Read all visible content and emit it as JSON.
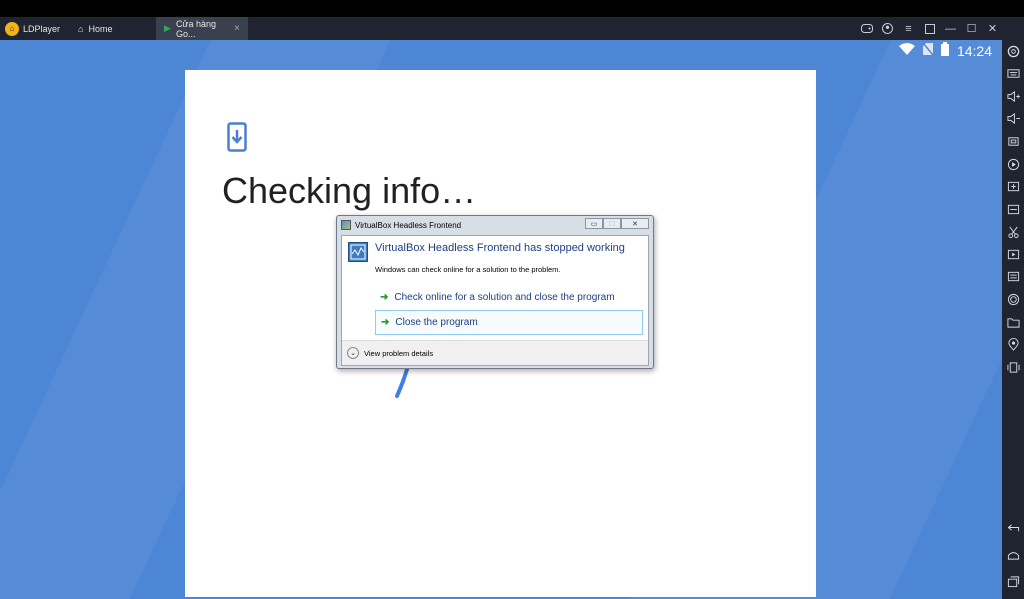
{
  "window": {
    "app_name": "LDPlayer",
    "tabs": [
      {
        "label": "Home",
        "icon": "home-icon"
      },
      {
        "label": "Cửa hàng Go...",
        "icon": "play-store-icon"
      }
    ],
    "controls": [
      "gamepad-icon",
      "account-icon",
      "menu-icon",
      "fullscreen-icon",
      "minimize-icon",
      "maximize-icon",
      "close-icon",
      "collapse-sidebar-icon"
    ]
  },
  "statusbar": {
    "time": "14:24",
    "icons": [
      "wifi-icon",
      "no-sim-icon",
      "battery-icon"
    ]
  },
  "screen": {
    "title": "Checking info…",
    "icon": "phone-download-icon"
  },
  "dialog": {
    "title": "VirtualBox Headless Frontend",
    "heading": "VirtualBox Headless Frontend has stopped working",
    "message": "Windows can check online for a solution to the problem.",
    "options": [
      "Check online for a solution and close the program",
      "Close the program"
    ],
    "details_label": "View problem details"
  },
  "sidebar": {
    "items": [
      "settings-icon",
      "keyboard-icon",
      "volume-up-icon",
      "volume-down-icon",
      "screenshot-icon",
      "record-icon",
      "add-apk-icon",
      "resolution-icon",
      "scissors-icon",
      "video-icon",
      "sync-icon",
      "rotate-icon",
      "folder-icon",
      "location-icon",
      "shake-icon",
      "back-icon",
      "home-icon",
      "recent-apps-icon"
    ]
  },
  "colors": {
    "background": "#4d86d5",
    "titlebar": "#1f2430",
    "dialog_heading": "#1e3f82",
    "logo": "#f2b21b"
  }
}
